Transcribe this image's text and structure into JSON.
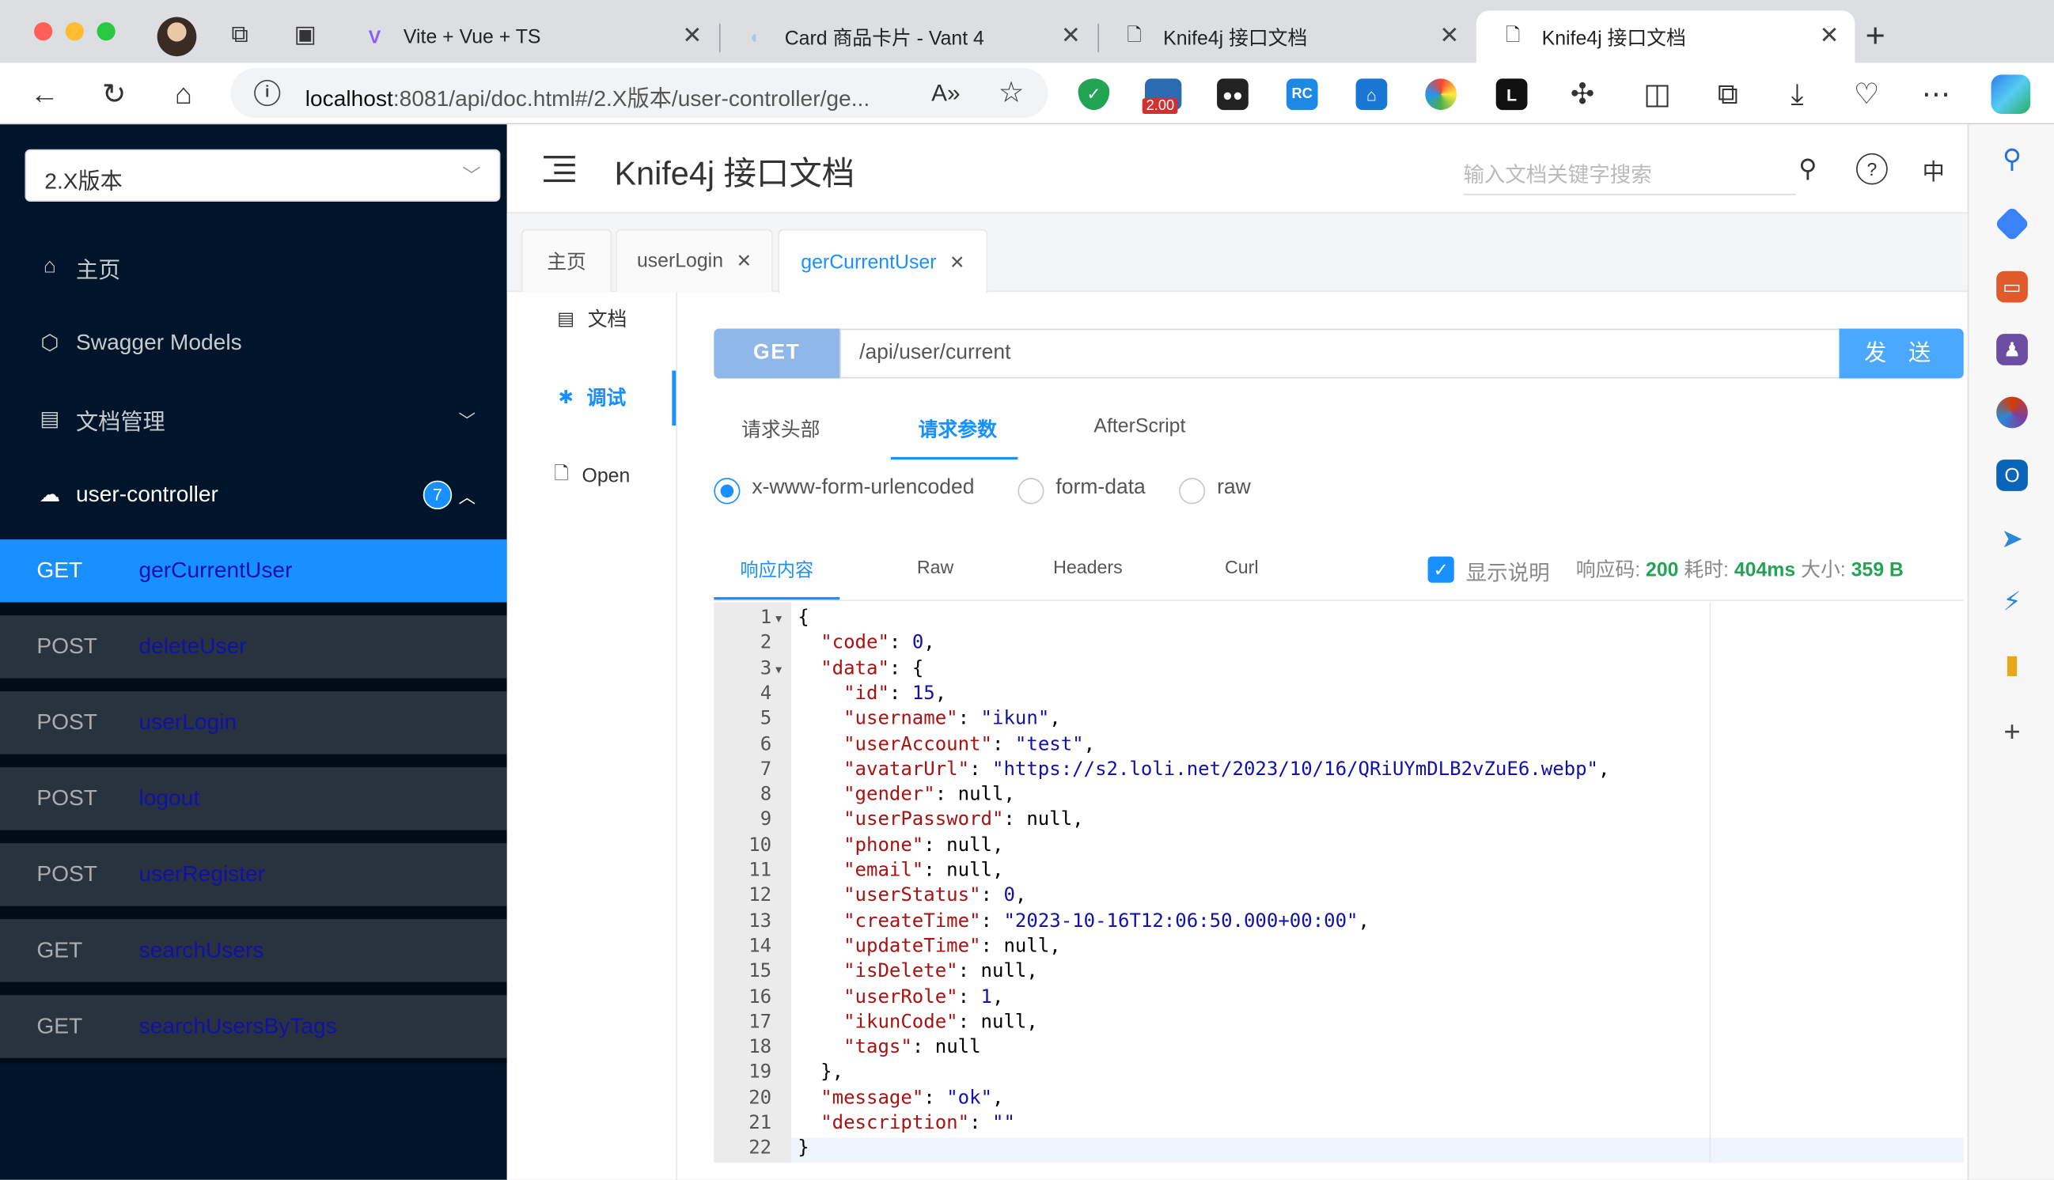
{
  "browser": {
    "tabs": [
      {
        "title": "",
        "icon": "collections-icon"
      },
      {
        "title": "Vite + Vue + TS",
        "icon": "vite-icon"
      },
      {
        "title": "Card 商品卡片 - Vant 4",
        "icon": "vant-icon"
      },
      {
        "title": "Knife4j 接口文档",
        "icon": "page-icon"
      },
      {
        "title": "Knife4j 接口文档",
        "icon": "page-icon"
      }
    ],
    "url_host": "localhost",
    "url_rest": ":8081/api/doc.html#/2.X版本/user-controller/ge...",
    "extension_badge": "2.00"
  },
  "sidebar": {
    "version": "2.X版本",
    "menu": [
      {
        "label": "主页",
        "icon": "home-icon"
      },
      {
        "label": "Swagger Models",
        "icon": "models-icon"
      },
      {
        "label": "文档管理",
        "icon": "doc-manage-icon"
      },
      {
        "label": "user-controller",
        "icon": "cloud-icon",
        "badge": "7"
      }
    ],
    "apis": [
      {
        "method": "GET",
        "name": "gerCurrentUser",
        "selected": true
      },
      {
        "method": "POST",
        "name": "deleteUser"
      },
      {
        "method": "POST",
        "name": "userLogin"
      },
      {
        "method": "POST",
        "name": "logout"
      },
      {
        "method": "POST",
        "name": "userRegister"
      },
      {
        "method": "GET",
        "name": "searchUsers"
      },
      {
        "method": "GET",
        "name": "searchUsersByTags"
      }
    ]
  },
  "header": {
    "title": "Knife4j 接口文档",
    "search_placeholder": "输入文档关键字搜索",
    "lang": "中"
  },
  "doc_tabs": [
    "主页",
    "userLogin",
    "gerCurrentUser"
  ],
  "vtabs": [
    "文档",
    "调试",
    "Open"
  ],
  "request": {
    "method": "GET",
    "path": "/api/user/current",
    "send": "发 送"
  },
  "param_tabs": [
    "请求头部",
    "请求参数",
    "AfterScript"
  ],
  "body_types": [
    "x-www-form-urlencoded",
    "form-data",
    "raw"
  ],
  "response": {
    "tabs": [
      "响应内容",
      "Raw",
      "Headers",
      "Curl"
    ],
    "show_desc": "显示说明",
    "code_label": "响应码:",
    "code": "200",
    "time_label": "耗时:",
    "time": "404ms",
    "size_label": "大小:",
    "size": "359 B"
  },
  "code_lines": [
    "{",
    "  \"code\": 0,",
    "  \"data\": {",
    "    \"id\": 15,",
    "    \"username\": \"ikun\",",
    "    \"userAccount\": \"test\",",
    "    \"avatarUrl\": \"https://s2.loli.net/2023/10/16/QRiUYmDLB2vZuE6.webp\",",
    "    \"gender\": null,",
    "    \"userPassword\": null,",
    "    \"phone\": null,",
    "    \"email\": null,",
    "    \"userStatus\": 0,",
    "    \"createTime\": \"2023-10-16T12:06:50.000+00:00\",",
    "    \"updateTime\": null,",
    "    \"isDelete\": null,",
    "    \"userRole\": 1,",
    "    \"ikunCode\": null,",
    "    \"tags\": null",
    "  },",
    "  \"message\": \"ok\",",
    "  \"description\": \"\"",
    "}"
  ],
  "colors": {
    "sidebar_bg": "#001529",
    "accent": "#1890ff",
    "success": "#23a455"
  }
}
